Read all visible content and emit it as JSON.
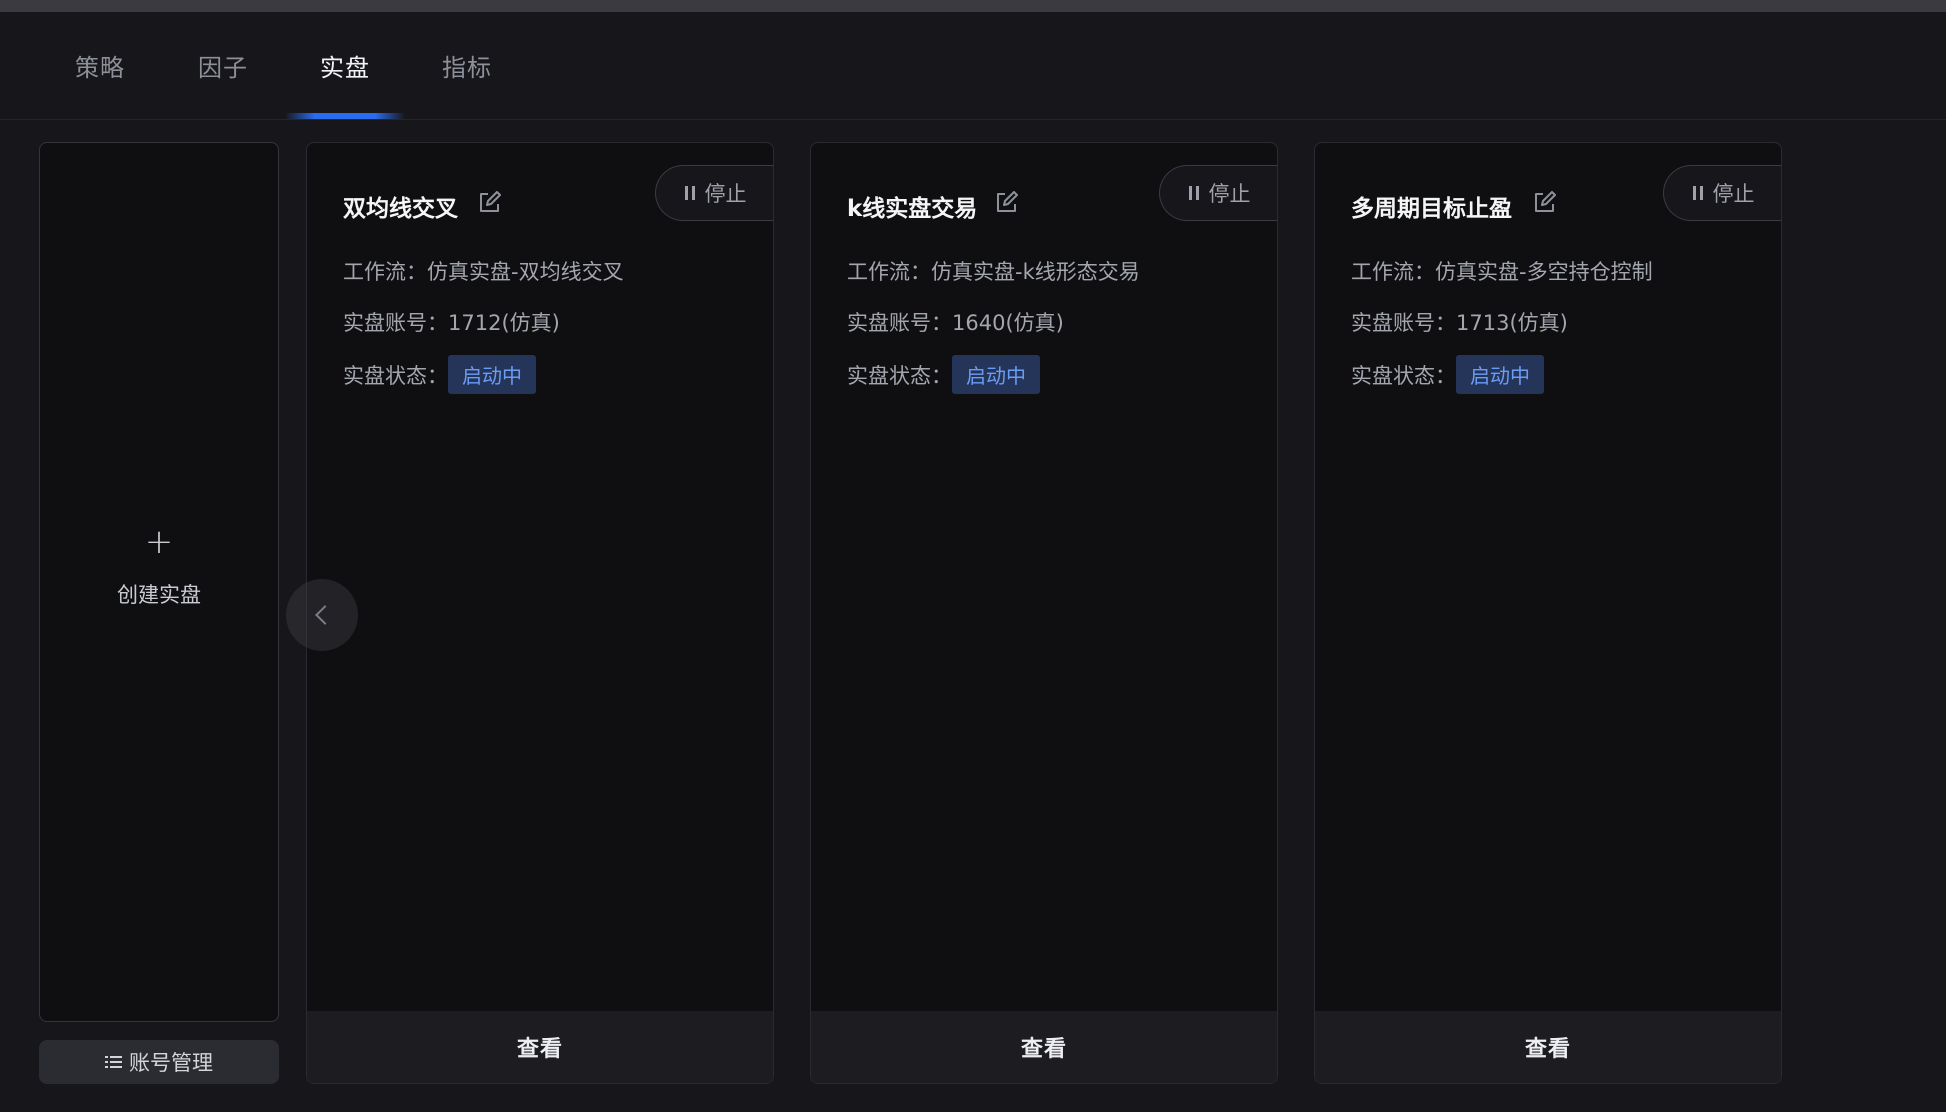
{
  "tabs": [
    {
      "label": "策略"
    },
    {
      "label": "因子"
    },
    {
      "label": "实盘"
    },
    {
      "label": "指标"
    }
  ],
  "active_tab": "实盘",
  "create": {
    "plus": "+",
    "label": "创建实盘"
  },
  "account_button": {
    "label": "账号管理",
    "icon": "list-icon"
  },
  "cards": [
    {
      "title": "双均线交叉",
      "stop_label": "停止",
      "workflow_label": "工作流：",
      "workflow_value": "仿真实盘-双均线交叉",
      "account_label": "实盘账号：",
      "account_value": "1712(仿真)",
      "status_label": "实盘状态：",
      "status_value": "启动中",
      "footer": "查看"
    },
    {
      "title": "k线实盘交易",
      "stop_label": "停止",
      "workflow_label": "工作流：",
      "workflow_value": "仿真实盘-k线形态交易",
      "account_label": "实盘账号：",
      "account_value": "1640(仿真)",
      "status_label": "实盘状态：",
      "status_value": "启动中",
      "footer": "查看"
    },
    {
      "title": "多周期目标止盈",
      "stop_label": "停止",
      "workflow_label": "工作流：",
      "workflow_value": "仿真实盘-多空持仓控制",
      "account_label": "实盘账号：",
      "account_value": "1713(仿真)",
      "status_label": "实盘状态：",
      "status_value": "启动中",
      "footer": "查看"
    }
  ],
  "colors": {
    "accent": "#2a6cf0",
    "status_bg": "#25355a",
    "status_text": "#6a9cf5",
    "background": "#17171b",
    "card": "#0f0f12"
  }
}
